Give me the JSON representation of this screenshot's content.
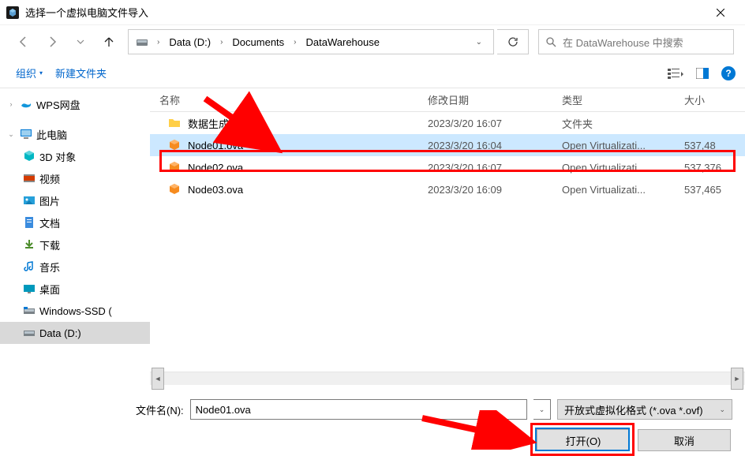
{
  "titlebar": {
    "title": "选择一个虚拟电脑文件导入"
  },
  "breadcrumbs": {
    "drive": "Data (D:)",
    "folder1": "Documents",
    "folder2": "DataWarehouse"
  },
  "search": {
    "placeholder": "在 DataWarehouse 中搜索"
  },
  "toolbar": {
    "organize": "组织",
    "new_folder": "新建文件夹"
  },
  "sidebar": {
    "wps": "WPS网盘",
    "this_pc": "此电脑",
    "three_d": "3D 对象",
    "videos": "视频",
    "pictures": "图片",
    "documents": "文档",
    "downloads": "下载",
    "music": "音乐",
    "desktop": "桌面",
    "win_ssd": "Windows-SSD (",
    "data_d": "Data (D:)"
  },
  "columns": {
    "name": "名称",
    "date": "修改日期",
    "type": "类型",
    "size": "大小"
  },
  "rows": [
    {
      "name": "数据生成脚本",
      "date": "2023/3/20 16:07",
      "type": "文件夹",
      "size": "",
      "icon": "folder"
    },
    {
      "name": "Node01.ova",
      "date": "2023/3/20 16:04",
      "type": "Open Virtualizati...",
      "size": "537,48",
      "icon": "ova"
    },
    {
      "name": "Node02.ova",
      "date": "2023/3/20 16:07",
      "type": "Open Virtualizati...",
      "size": "537,376",
      "icon": "ova"
    },
    {
      "name": "Node03.ova",
      "date": "2023/3/20 16:09",
      "type": "Open Virtualizati...",
      "size": "537,465",
      "icon": "ova"
    }
  ],
  "filename": {
    "label": "文件名(N):",
    "value": "Node01.ova"
  },
  "filetype": {
    "label": "开放式虚拟化格式 (*.ova *.ovf)"
  },
  "buttons": {
    "open": "打开(O)",
    "cancel": "取消"
  }
}
